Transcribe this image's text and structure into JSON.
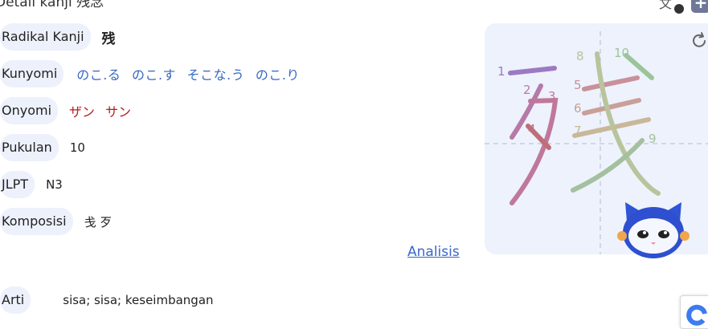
{
  "header": {
    "title": "Detail kanji 残念"
  },
  "details": {
    "radical_label": "Radikal Kanji",
    "radical_value": "残",
    "kunyomi_label": "Kunyomi",
    "kunyomi_values": [
      "のこ.る",
      "のこ.す",
      "そこな.う",
      "のこ.り"
    ],
    "onyomi_label": "Onyomi",
    "onyomi_values": [
      "ザン",
      "サン"
    ],
    "strokes_label": "Pukulan",
    "strokes_value": "10",
    "jlpt_label": "JLPT",
    "jlpt_value": "N3",
    "composition_label": "Komposisi",
    "composition_value": "戋 歹",
    "analysis_link": "Analisis",
    "meaning_label": "Arti",
    "meaning_value": "sisa; sisa; keseimbangan"
  },
  "stroke_order": {
    "numbers": [
      "1",
      "2",
      "3",
      "4",
      "5",
      "6",
      "7",
      "8",
      "9",
      "10"
    ]
  },
  "icons": {
    "translate": "translate-icon",
    "add": "add-icon",
    "replay": "replay-icon",
    "mascot": "robot-cat-mascot",
    "corner": "google-translate-icon"
  },
  "colors": {
    "chip_bg": "#edf1fc",
    "kunyomi": "#3568c4",
    "onyomi": "#b71c1c",
    "link": "#3a66c8"
  }
}
